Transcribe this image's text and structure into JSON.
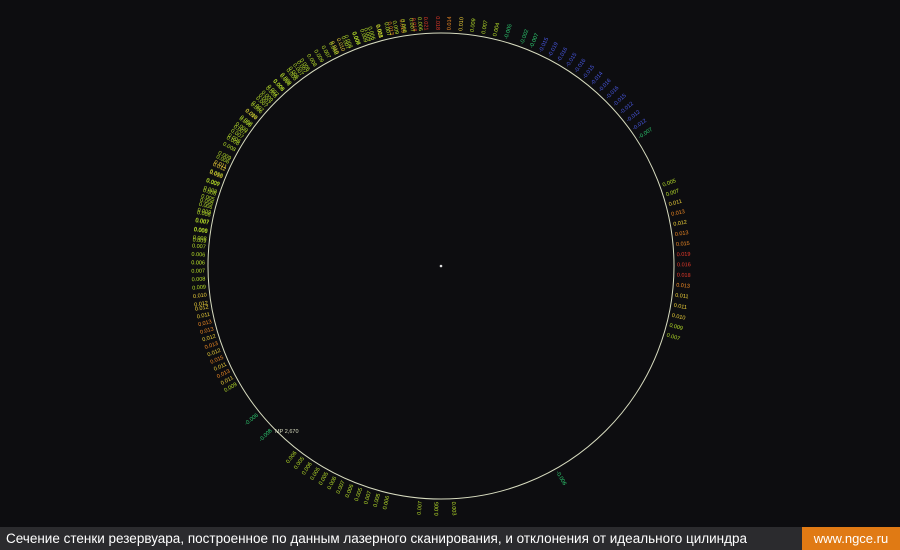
{
  "diagram": {
    "colors": {
      "background": "#0d0d10",
      "circle": "#d8dcc0",
      "center_point": "#e0e0e0",
      "negative_small": "#2ecc71",
      "positive_small": "#b8e02a",
      "positive_medium": "#f0d23a",
      "positive_large": "#f08a24",
      "positive_max": "#e83a2a",
      "negative_large": "#4a5ae8"
    },
    "marker_label": "МР 2,670",
    "groups": [
      {
        "from": -84,
        "to": -35,
        "values": [
          "0.009",
          "0.006",
          "0.007",
          "0.009",
          "0.008",
          "0.006",
          "0.007",
          "0.008",
          "0.011",
          "0.009",
          "0.008",
          "0.006",
          "0.007",
          "0.008",
          "0.009",
          "0.007",
          "0.007",
          "0.008",
          "0.008",
          "0.009",
          "0.006",
          "0.007"
        ]
      },
      {
        "from": -26,
        "to": 16,
        "values": [
          "0.010",
          "0.007",
          "0.008",
          "0.009",
          "0.011",
          "0.013",
          "0.015",
          "0.018",
          "0.021",
          "0.018",
          "0.014",
          "0.010",
          "0.009",
          "0.007",
          "0.004",
          "-0.005"
        ]
      },
      {
        "from": 20,
        "to": 57,
        "values": [
          "-0.002",
          "-0.007",
          "-0.015",
          "-0.019",
          "-0.016",
          "-0.015",
          "-0.016",
          "-0.015",
          "-0.014",
          "-0.016",
          "-0.016",
          "-0.015",
          "-0.012",
          "-0.012",
          "-0.012",
          "-0.007"
        ]
      },
      {
        "from": 70,
        "to": 107,
        "values": [
          "0.005",
          "0.007",
          "0.011",
          "0.013",
          "0.012",
          "0.013",
          "0.015",
          "0.019",
          "0.016",
          "0.018",
          "0.013",
          "0.011",
          "0.011",
          "0.010",
          "0.009",
          "0.007"
        ]
      },
      {
        "from": 145,
        "to": 156,
        "values": [
          "-0.006"
        ]
      },
      {
        "from": 177,
        "to": 185,
        "values": [
          "0.003",
          "0.005",
          "0.007"
        ]
      },
      {
        "from": 193,
        "to": 218,
        "values": [
          "0.006",
          "0.005",
          "0.007",
          "0.005",
          "0.006",
          "0.007",
          "0.006",
          "0.005",
          "0.005",
          "0.006",
          "0.005",
          "0.006"
        ]
      },
      {
        "from": 226,
        "to": 231,
        "values": [
          "-0.008",
          "-0.006"
        ]
      },
      {
        "from": 240,
        "to": 260,
        "values": [
          "0.009",
          "0.011",
          "0.013",
          "0.011",
          "0.015",
          "0.012",
          "0.013",
          "0.012",
          "0.013",
          "0.013",
          "0.011",
          "0.012"
        ]
      },
      {
        "from": 261,
        "to": 296,
        "values": [
          "0.012",
          "0.010",
          "0.009",
          "0.008",
          "0.007",
          "0.006",
          "0.006",
          "0.007",
          "0.008",
          "0.009",
          "0.007",
          "0.008",
          "0.006",
          "0.005",
          "0.008",
          "0.009",
          "0.010",
          "0.012",
          "0.006"
        ]
      },
      {
        "from": 301,
        "to": 320,
        "values": [
          "0.006",
          "0.007",
          "0.009",
          "0.008",
          "0.010",
          "0.006",
          "0.007",
          "0.009",
          "0.007",
          "0.008",
          "0.006"
        ]
      },
      {
        "from": 322,
        "to": 355,
        "values": [
          "0.005",
          "0.007",
          "0.006",
          "0.008",
          "0.009",
          "0.007",
          "0.008",
          "0.010",
          "0.008",
          "0.007",
          "0.009",
          "0.006",
          "0.008",
          "0.007",
          "0.009",
          "0.008",
          "0.007",
          "0.006"
        ]
      }
    ]
  },
  "caption": {
    "text": "Сечение стенки резервуара, построенное по данным лазерного сканирования, и отклонения от идеального цилиндра",
    "site": "www.ngce.ru"
  }
}
